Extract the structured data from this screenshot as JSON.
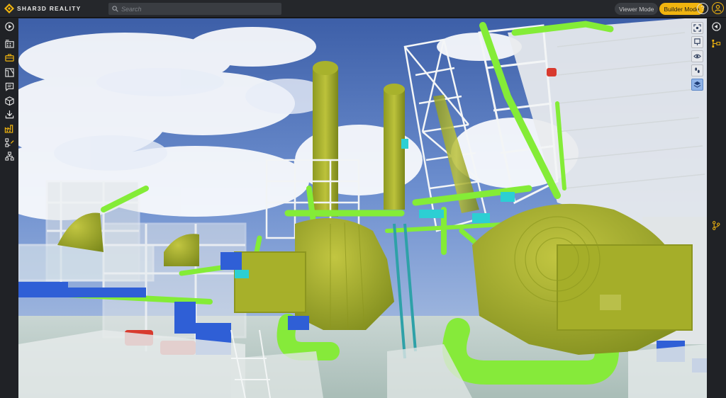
{
  "app": {
    "logo_text": "SHAR3D REALITY"
  },
  "search": {
    "placeholder": "Search",
    "value": ""
  },
  "modes": {
    "viewer_label": "Viewer Mode",
    "builder_label": "Builder Mode",
    "active": "builder"
  },
  "header": {
    "help_label": "?"
  },
  "left_sidebar": {
    "items": [
      {
        "icon": "play-circle-icon"
      },
      {
        "icon": "building-icon"
      },
      {
        "icon": "briefcase-icon"
      },
      {
        "icon": "blueprint-icon"
      },
      {
        "icon": "comment-icon"
      },
      {
        "icon": "cube-icon"
      },
      {
        "icon": "download-icon"
      },
      {
        "icon": "factory-icon"
      },
      {
        "icon": "flow-edit-icon"
      },
      {
        "icon": "hierarchy-icon"
      }
    ]
  },
  "right_sidebar": {
    "items": [
      {
        "icon": "collapse-left-icon"
      },
      {
        "icon": "hierarchy-tag-icon"
      },
      {
        "icon": "branch-icon"
      }
    ]
  },
  "viewport_tools": {
    "items": [
      {
        "icon": "focus-frame-icon"
      },
      {
        "icon": "map-pin-icon"
      },
      {
        "icon": "eye-icon"
      },
      {
        "icon": "footsteps-icon"
      },
      {
        "icon": "layers-active-icon",
        "active": true
      }
    ]
  },
  "colors": {
    "accent": "#f0b40f",
    "toolbar_bg": "#25272b",
    "sidebar_bg": "#202226",
    "pipe_green": "#7ee83a",
    "vessel_olive": "#a7b02a",
    "equipment_blue": "#2f5fd6",
    "motor_red": "#d83a2e",
    "instrument_cyan": "#2ccfd3"
  }
}
